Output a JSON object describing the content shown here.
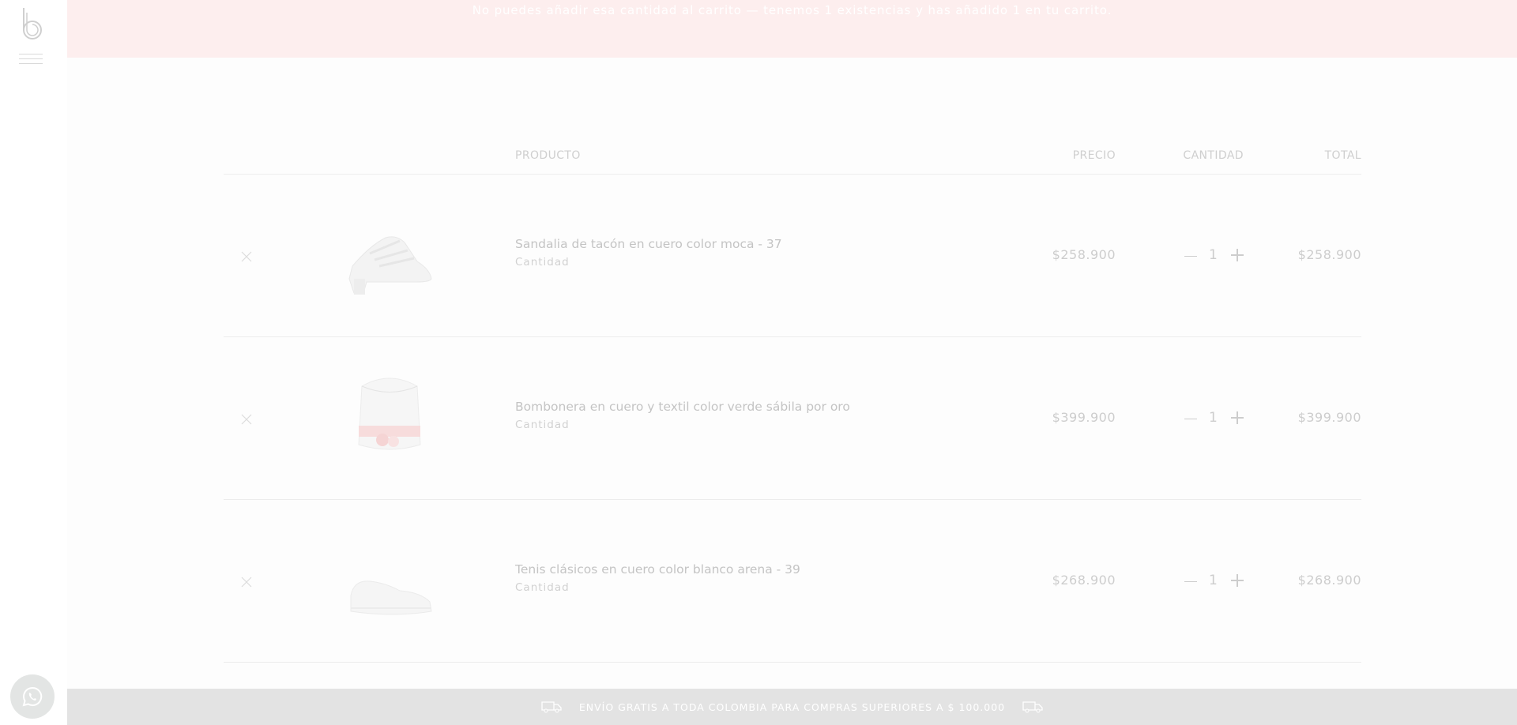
{
  "notice": {
    "message": "No puedes añadir esa cantidad al carrito — tenemos 1 existencias y has añadido 1 en tu carrito."
  },
  "cart": {
    "headers": {
      "product": "PRODUCTO",
      "price": "PRECIO",
      "quantity": "CANTIDAD",
      "total": "TOTAL"
    },
    "items": [
      {
        "name": "Sandalia de tacón en cuero color moca - 37",
        "meta": "Cantidad",
        "price": "$258.900",
        "quantity": "1",
        "total": "$258.900",
        "image": "sandal"
      },
      {
        "name": "Bombonera en cuero y textil color verde sábila por oro",
        "meta": "Cantidad",
        "price": "$399.900",
        "quantity": "1",
        "total": "$399.900",
        "image": "bucket-bag"
      },
      {
        "name": "Tenis clásicos en cuero color blanco arena - 39",
        "meta": "Cantidad",
        "price": "$268.900",
        "quantity": "1",
        "total": "$268.900",
        "image": "sneaker"
      }
    ]
  },
  "shipping": {
    "text": "ENVÍO GRATIS A TODA COLOMBIA PARA COMPRAS SUPERIORES A $ 100.000"
  },
  "icons": {
    "logo": "b-logo",
    "menu": "hamburger-menu-icon",
    "whatsapp": "whatsapp-icon",
    "remove": "close-icon",
    "truck": "truck-icon"
  },
  "colors": {
    "notice_bg": "#fdeeee",
    "shipping_bg": "#e3e3e3",
    "text_faded": "#c9c9c9"
  }
}
